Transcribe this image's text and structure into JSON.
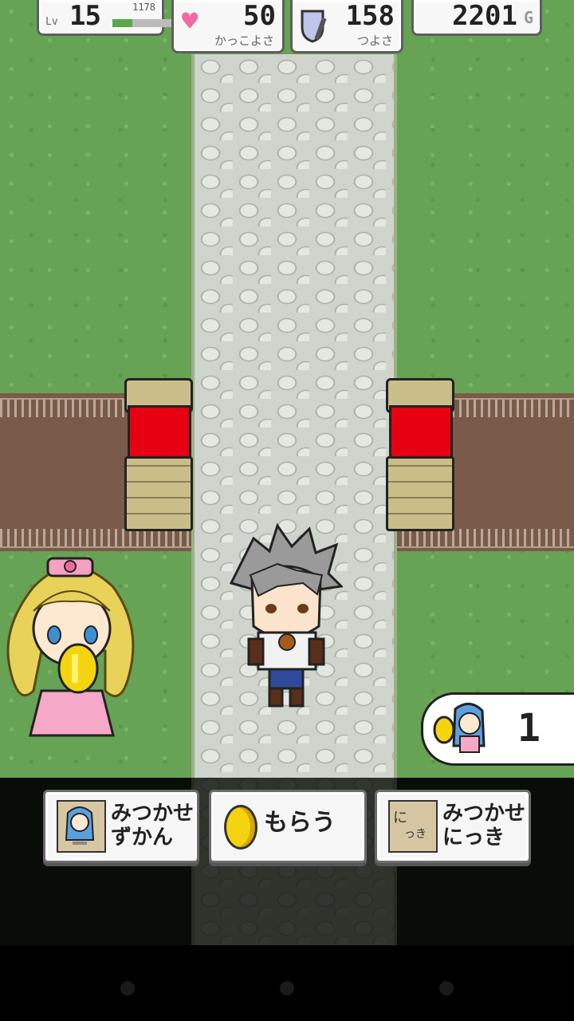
{
  "hud": {
    "level_tag": "Lv",
    "level": "15",
    "exp": "1178",
    "exp_progress": 0.25,
    "charm_value": "50",
    "charm_label": "かっこよさ",
    "power_value": "158",
    "power_label": "つよさ",
    "gold_value": "2201",
    "gold_unit": "G"
  },
  "finder_counter": {
    "value": "1"
  },
  "buttons": {
    "zukan_label": "みつかせ\nずかん",
    "get_label": "もらう",
    "diary_label": "みつかせ\nにっき",
    "diary_icon_text": "に",
    "diary_icon_text2": "っき"
  },
  "icons": [
    "heart-icon",
    "shield-sword-icon",
    "coin-icon",
    "zukan-book-icon",
    "diary-icon"
  ],
  "colors": {
    "grass": "#67a355",
    "path": "#cfd4cc",
    "gate_red": "#e60012",
    "gold": "#f4d410"
  }
}
